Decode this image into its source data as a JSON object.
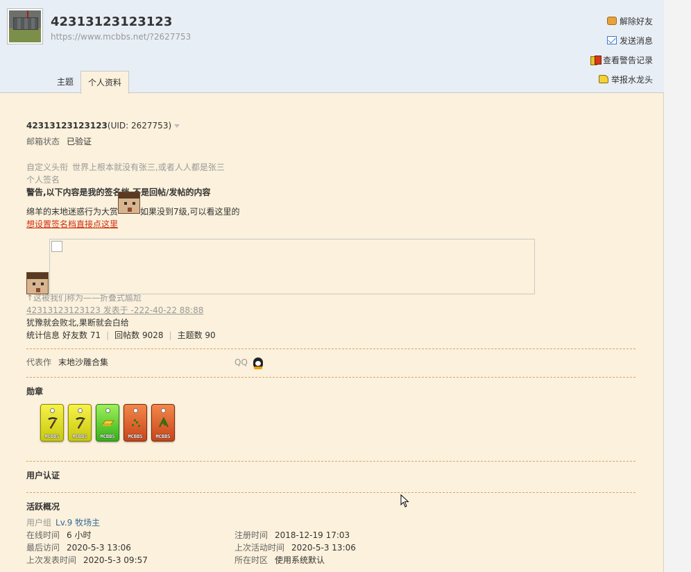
{
  "profile": {
    "name": "42313123123123",
    "url": "https://www.mcbbs.net/?2627753",
    "uid_text": "(UID: 2627753)"
  },
  "tabs": [
    {
      "label": "主题"
    },
    {
      "label": "个人资料"
    }
  ],
  "actions": [
    {
      "label": "解除好友",
      "icon": "handshake-icon"
    },
    {
      "label": "发送消息",
      "icon": "mail-icon"
    },
    {
      "label": "查看警告记录",
      "icon": "warning-card-icon"
    },
    {
      "label": "举报水龙头",
      "icon": "faucet-icon"
    }
  ],
  "info": {
    "email_label": "邮箱状态",
    "email_value": "已验证",
    "title_label": "自定义头衔",
    "title_value": "世界上根本就没有张三,或者人人都是张三",
    "sig_label": "个人签名",
    "sig_line1": "警告,以下内容是我的签名档,不是回帖/发帖的内容",
    "sig_line2a": "绵羊的末地迷惑行为大赏",
    "sig_line2b": "如果没到7级,可以看这里的",
    "sig_link": "想设置签名档直接点这里",
    "caption": "↑这被我们称为——折叠式尴尬",
    "post_link": "42313123123123 发表于 -222-40-22 88:88",
    "motto": "犹豫就会败北,果断就会白给",
    "stats_label": "统计信息",
    "friends": "好友数 71",
    "replies": "回帖数 9028",
    "threads": "主题数 90"
  },
  "works": {
    "label": "代表作",
    "value": "末地沙雕合集",
    "qq_label": "QQ"
  },
  "medals": {
    "title": "勋章",
    "items": [
      {
        "color": "yellow",
        "brand": "MCBBS",
        "icon": "pickaxe-icon"
      },
      {
        "color": "yellow",
        "brand": "MCBBS",
        "icon": "pickaxe-icon"
      },
      {
        "color": "green",
        "brand": "MCBBS",
        "icon": "gold-ingot-icon"
      },
      {
        "color": "orange",
        "brand": "MCBBS",
        "icon": "seeds-icon"
      },
      {
        "color": "orange",
        "brand": "MCBBS",
        "icon": "plant-icon"
      }
    ]
  },
  "auth": {
    "title": "用户认证"
  },
  "activity": {
    "title": "活跃概况",
    "group_label": "用户组",
    "group_value": "Lv.9 牧场主",
    "online_label": "在线时间",
    "online_value": "6 小时",
    "reg_label": "注册时间",
    "reg_value": "2018-12-19 17:03",
    "lastvisit_label": "最后访问",
    "lastvisit_value": "2020-5-3 13:06",
    "lastactive_label": "上次活动时间",
    "lastactive_value": "2020-5-3 13:06",
    "lastpost_label": "上次发表时间",
    "lastpost_value": "2020-5-3 09:57",
    "tz_label": "所在时区",
    "tz_value": "使用系统默认"
  },
  "colors": {
    "header_bg": "#e8eef6",
    "content_bg": "#fbf1dc",
    "link_red": "#d03010",
    "link_blue": "#336699"
  }
}
